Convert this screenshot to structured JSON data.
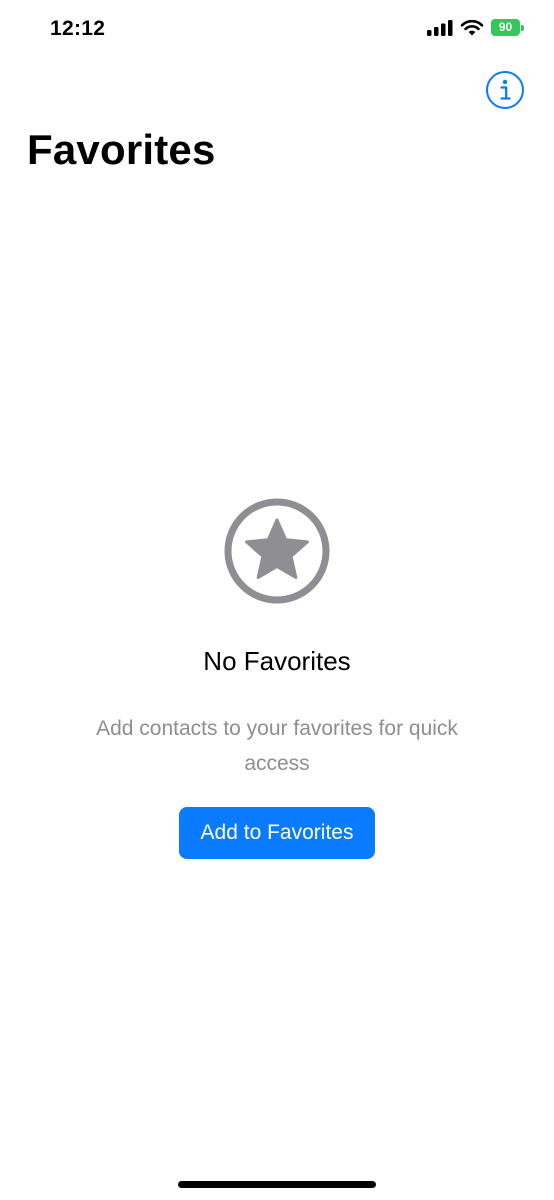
{
  "status_bar": {
    "time": "12:12",
    "battery_level": "90",
    "battery_color": "#34c759",
    "icons": [
      "signal-icon",
      "wifi-icon",
      "battery-icon"
    ]
  },
  "header": {
    "info_icon": "info-icon",
    "title": "Favorites"
  },
  "empty_state": {
    "icon": "star-icon",
    "icon_color": "#8e8e93",
    "title": "No Favorites",
    "subtitle": "Add contacts to your favorites for quick access",
    "button_label": "Add to Favorites"
  },
  "colors": {
    "accent": "#0a7aff",
    "secondary_text": "#8e8e93"
  }
}
